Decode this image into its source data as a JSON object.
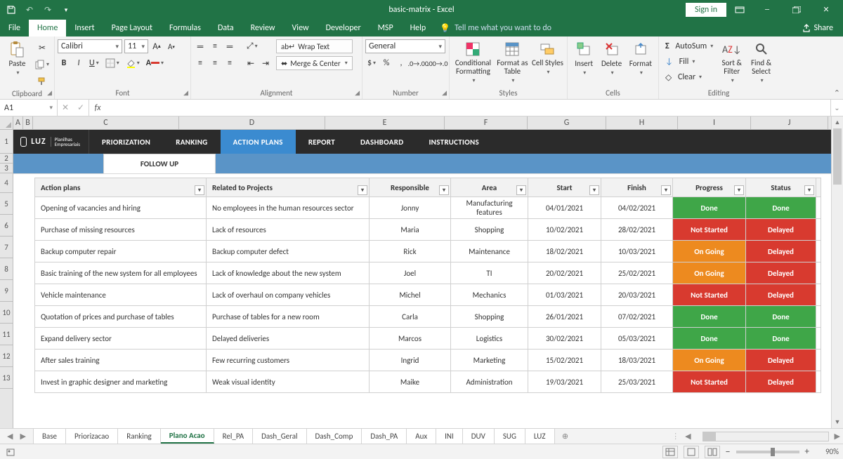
{
  "titlebar": {
    "title": "basic-matrix  -  Excel",
    "signin": "Sign in"
  },
  "menu": {
    "tabs": [
      "File",
      "Home",
      "Insert",
      "Page Layout",
      "Formulas",
      "Data",
      "Review",
      "View",
      "Developer",
      "MSP",
      "Help"
    ],
    "active": "Home",
    "tellme": "Tell me what you want to do",
    "share": "Share"
  },
  "ribbon": {
    "clipboard": {
      "label": "Clipboard",
      "paste": "Paste"
    },
    "font": {
      "label": "Font",
      "name": "Calibri",
      "size": "11"
    },
    "alignment": {
      "label": "Alignment",
      "wrap": "Wrap Text",
      "merge": "Merge & Center"
    },
    "number": {
      "label": "Number",
      "format": "General"
    },
    "styles": {
      "label": "Styles",
      "cf": "Conditional Formatting",
      "fat": "Format as Table",
      "cs": "Cell Styles"
    },
    "cells": {
      "label": "Cells",
      "insert": "Insert",
      "delete": "Delete",
      "format": "Format"
    },
    "editing": {
      "label": "Editing",
      "autosum": "AutoSum",
      "fill": "Fill",
      "clear": "Clear",
      "sort": "Sort & Filter",
      "find": "Find & Select"
    }
  },
  "formula": {
    "cell": "A1",
    "value": ""
  },
  "cols": [
    "A",
    "B",
    "C",
    "D",
    "E",
    "F",
    "G",
    "H",
    "I",
    "J"
  ],
  "rows": [
    "1",
    "2",
    "3",
    "4",
    "5",
    "6",
    "7",
    "8",
    "9",
    "10",
    "11",
    "12",
    "13"
  ],
  "luz": {
    "brand": "LUZ",
    "sub": "Planilhas Empresariais"
  },
  "nav": {
    "items": [
      "PRIORIZATION",
      "RANKING",
      "ACTION PLANS",
      "REPORT",
      "DASHBOARD",
      "INSTRUCTIONS"
    ],
    "active": "ACTION PLANS"
  },
  "subtab": "FOLLOW UP",
  "table": {
    "headers": [
      "Action plans",
      "Related to Projects",
      "Responsible",
      "Area",
      "Start",
      "Finish",
      "Progress",
      "Status"
    ],
    "rows": [
      {
        "ap": "Opening of vacancies and hiring",
        "rp": "No employees in the human resources sector",
        "resp": "Jonny",
        "area": "Manufacturing features",
        "start": "04/01/2021",
        "fin": "04/02/2021",
        "prog": "Done",
        "stat": "Done",
        "pc": "bg-done",
        "sc": "bg-done"
      },
      {
        "ap": "Purchase of missing resources",
        "rp": "Lack of resources",
        "resp": "Maria",
        "area": "Shopping",
        "start": "10/02/2021",
        "fin": "28/02/2021",
        "prog": "Not Started",
        "stat": "Delayed",
        "pc": "bg-ns",
        "sc": "bg-del"
      },
      {
        "ap": "Backup computer repair",
        "rp": "Backup computer defect",
        "resp": "Rick",
        "area": "Maintenance",
        "start": "18/02/2021",
        "fin": "10/03/2021",
        "prog": "On Going",
        "stat": "Delayed",
        "pc": "bg-og",
        "sc": "bg-del"
      },
      {
        "ap": "Basic training of the new system for all employees",
        "rp": "Lack of knowledge about the new system",
        "resp": "Joel",
        "area": "TI",
        "start": "20/02/2021",
        "fin": "25/02/2021",
        "prog": "On Going",
        "stat": "Delayed",
        "pc": "bg-og",
        "sc": "bg-del"
      },
      {
        "ap": "Vehicle maintenance",
        "rp": "Lack of overhaul on company vehicles",
        "resp": "Michel",
        "area": "Mechanics",
        "start": "01/03/2021",
        "fin": "20/03/2021",
        "prog": "Not Started",
        "stat": "Delayed",
        "pc": "bg-ns",
        "sc": "bg-del"
      },
      {
        "ap": "Quotation of prices and purchase of tables",
        "rp": "Purchase of tables for a new room",
        "resp": "Carla",
        "area": "Shopping",
        "start": "26/01/2021",
        "fin": "07/02/2021",
        "prog": "Done",
        "stat": "Done",
        "pc": "bg-done",
        "sc": "bg-done"
      },
      {
        "ap": "Expand delivery sector",
        "rp": "Delayed deliveries",
        "resp": "Marcos",
        "area": "Logistics",
        "start": "30/02/2021",
        "fin": "05/03/2021",
        "prog": "Done",
        "stat": "Done",
        "pc": "bg-done",
        "sc": "bg-done"
      },
      {
        "ap": "After sales training",
        "rp": "Few recurring customers",
        "resp": "Ingrid",
        "area": "Marketing",
        "start": "15/02/2021",
        "fin": "18/03/2021",
        "prog": "On Going",
        "stat": "Delayed",
        "pc": "bg-og",
        "sc": "bg-del"
      },
      {
        "ap": "Invest in graphic designer and marketing",
        "rp": "Weak visual identity",
        "resp": "Maike",
        "area": "Administration",
        "start": "19/03/2021",
        "fin": "25/03/2021",
        "prog": "Not Started",
        "stat": "Delayed",
        "pc": "bg-ns",
        "sc": "bg-del"
      }
    ]
  },
  "sheettabs": {
    "items": [
      "Base",
      "Priorizacao",
      "Ranking",
      "Plano Acao",
      "Rel_PA",
      "Dash_Geral",
      "Dash_Comp",
      "Dash_PA",
      "Aux",
      "INI",
      "DUV",
      "SUG",
      "LUZ"
    ],
    "active": "Plano Acao"
  },
  "status": {
    "ready": "",
    "zoom": "90%"
  }
}
